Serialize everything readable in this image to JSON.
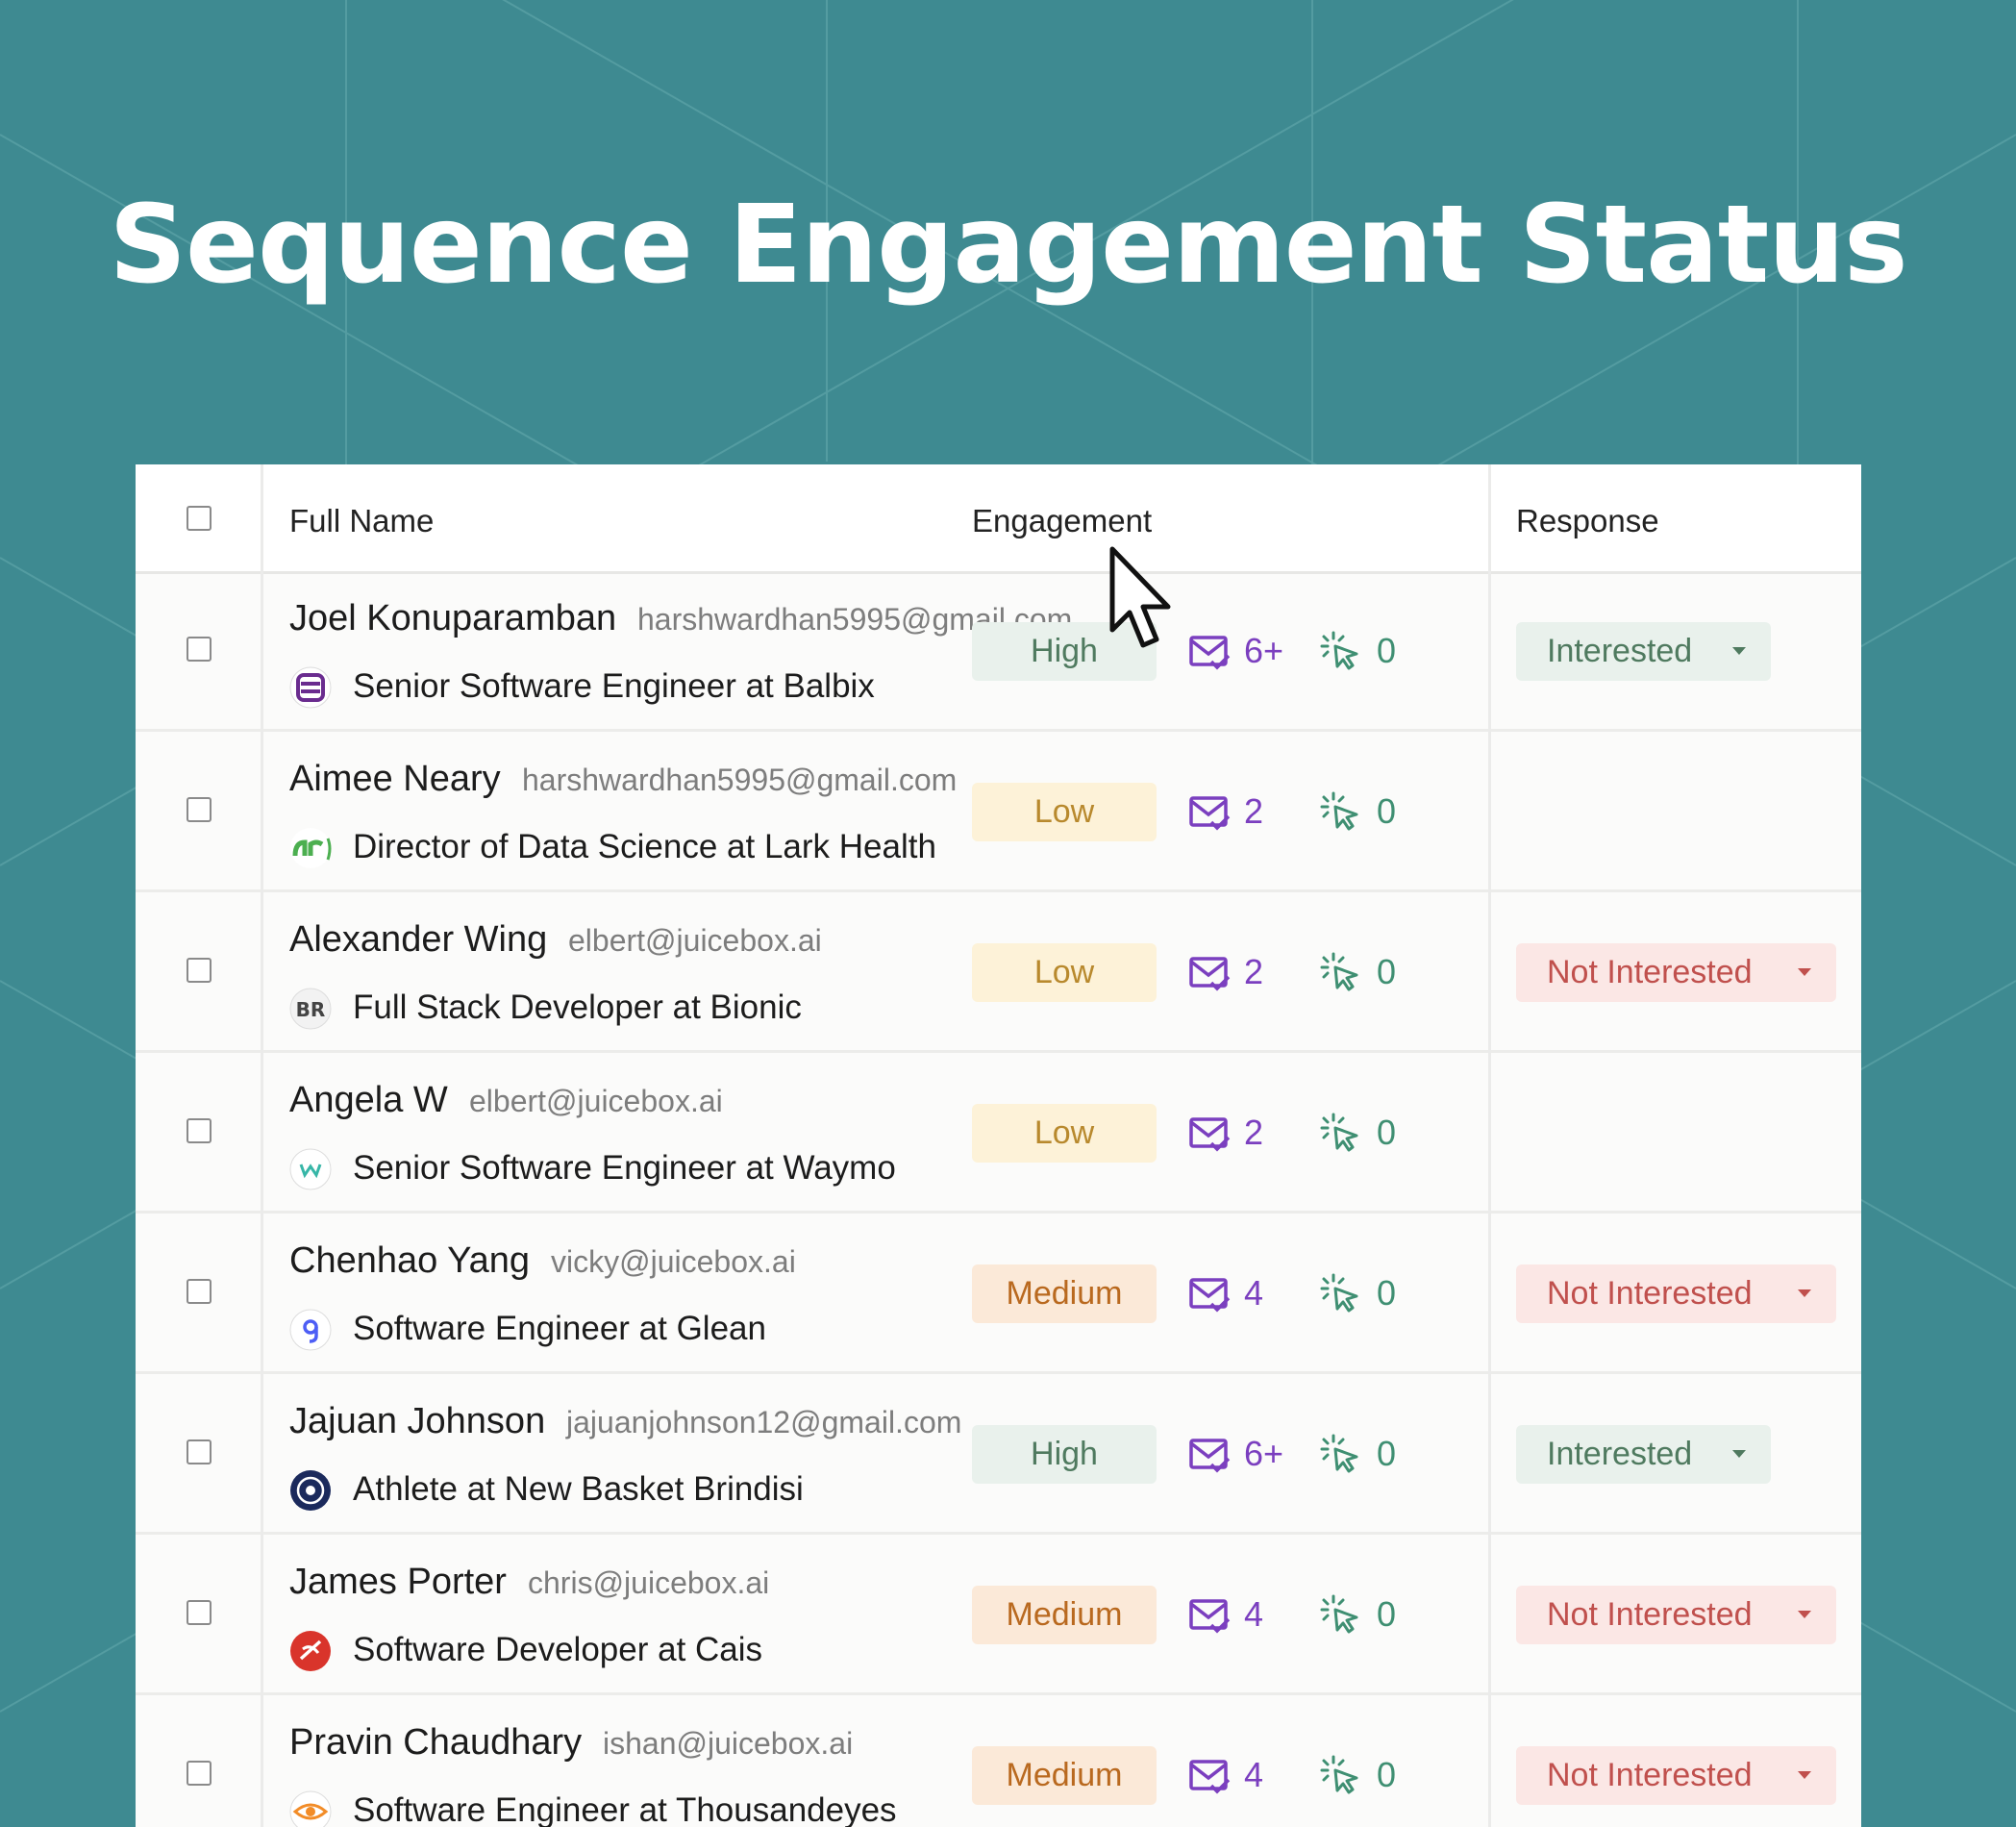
{
  "title": "Sequence Engagement Status",
  "colors": {
    "background": "#3e8a91",
    "high_bg": "#e9f1ec",
    "high_fg": "#4f7a5f",
    "low_bg": "#fdf2d8",
    "low_fg": "#b8892d",
    "medium_bg": "#fbe9d8",
    "medium_fg": "#b9691f",
    "interested_bg": "#e9f1ec",
    "interested_fg": "#4f7a5f",
    "not_interested_bg": "#fbe7e5",
    "not_interested_fg": "#c0504d",
    "mail": "#7b3fbf",
    "click": "#3f8f72"
  },
  "table": {
    "headers": {
      "full_name": "Full Name",
      "engagement": "Engagement",
      "response": "Response"
    },
    "rows": [
      {
        "name": "Joel Konuparamban",
        "email": "harshwardhan5995@gmail.com",
        "job": "Senior Software Engineer at Balbix",
        "logo": "balbix-logo",
        "engagement": "High",
        "emails": "6+",
        "clicks": "0",
        "response": "Interested"
      },
      {
        "name": "Aimee Neary",
        "email": "harshwardhan5995@gmail.com",
        "job": "Director of Data Science at Lark Health",
        "logo": "lark-logo",
        "engagement": "Low",
        "emails": "2",
        "clicks": "0",
        "response": ""
      },
      {
        "name": "Alexander Wing",
        "email": "elbert@juicebox.ai",
        "job": "Full Stack Developer at Bionic",
        "logo": "bionic-logo",
        "engagement": "Low",
        "emails": "2",
        "clicks": "0",
        "response": "Not Interested"
      },
      {
        "name": "Angela W",
        "email": "elbert@juicebox.ai",
        "job": "Senior Software Engineer at Waymo",
        "logo": "waymo-logo",
        "engagement": "Low",
        "emails": "2",
        "clicks": "0",
        "response": ""
      },
      {
        "name": "Chenhao Yang",
        "email": "vicky@juicebox.ai",
        "job": "Software Engineer at Glean",
        "logo": "glean-logo",
        "engagement": "Medium",
        "emails": "4",
        "clicks": "0",
        "response": "Not Interested"
      },
      {
        "name": "Jajuan Johnson",
        "email": "jajuanjohnson12@gmail.com",
        "job": "Athlete at New Basket Brindisi",
        "logo": "brindisi-logo",
        "engagement": "High",
        "emails": "6+",
        "clicks": "0",
        "response": "Interested"
      },
      {
        "name": "James Porter",
        "email": "chris@juicebox.ai",
        "job": "Software Developer at Cais",
        "logo": "cais-logo",
        "engagement": "Medium",
        "emails": "4",
        "clicks": "0",
        "response": "Not Interested"
      },
      {
        "name": "Pravin Chaudhary",
        "email": "ishan@juicebox.ai",
        "job": "Software Engineer at Thousandeyes",
        "logo": "thousandeyes-logo",
        "engagement": "Medium",
        "emails": "4",
        "clicks": "0",
        "response": "Not Interested"
      }
    ]
  }
}
